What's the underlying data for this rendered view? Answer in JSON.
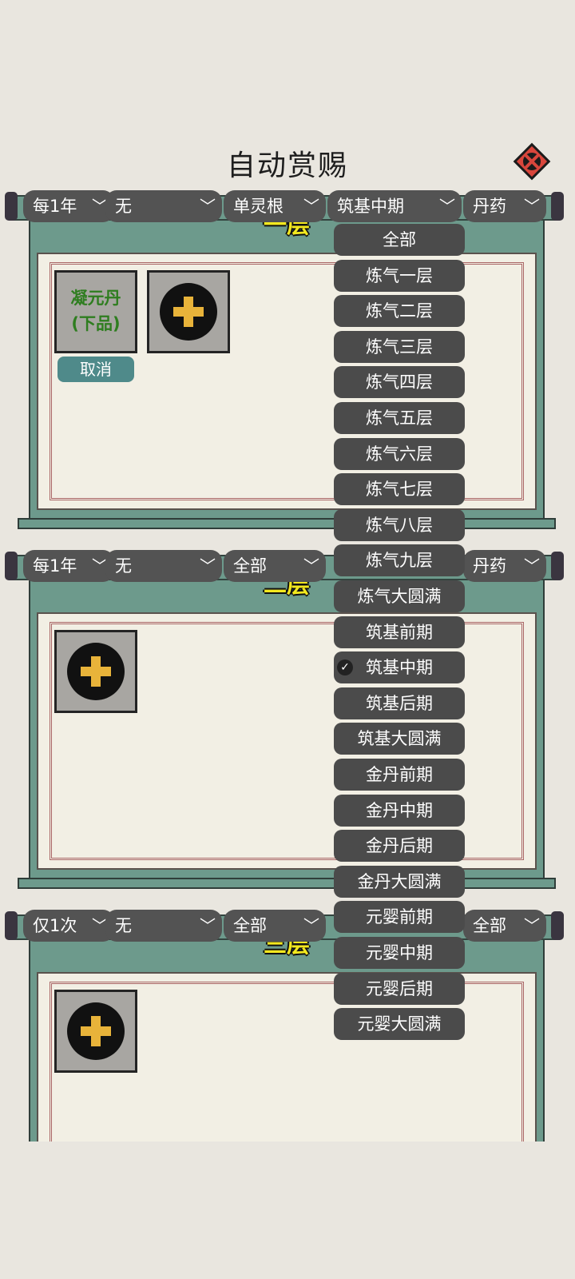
{
  "title": "自动赏赐",
  "close_icon": "close-icon",
  "rows": [
    {
      "freq": "每1年",
      "item": "无",
      "root": "单灵根",
      "realm": "筑基中期",
      "category": "丹药",
      "panel_label": "一层",
      "slot_item": "凝元丹",
      "slot_item_grade": "(下品)",
      "cancel": "取消"
    },
    {
      "freq": "每1年",
      "item": "无",
      "root": "全部",
      "realm": "",
      "category": "丹药",
      "panel_label": "二层"
    },
    {
      "freq": "仅1次",
      "item": "无",
      "root": "全部",
      "realm": "",
      "category": "全部",
      "panel_label": "三层"
    }
  ],
  "realm_menu": {
    "selected": "筑基中期",
    "options": [
      "全部",
      "炼气一层",
      "炼气二层",
      "炼气三层",
      "炼气四层",
      "炼气五层",
      "炼气六层",
      "炼气七层",
      "炼气八层",
      "炼气九层",
      "炼气大圆满",
      "筑基前期",
      "筑基中期",
      "筑基后期",
      "筑基大圆满",
      "金丹前期",
      "金丹中期",
      "金丹后期",
      "金丹大圆满",
      "元婴前期",
      "元婴中期",
      "元婴后期",
      "元婴大圆满"
    ]
  },
  "colors": {
    "panel": "#6d9a8c",
    "label": "#f3e81f",
    "dropdown": "#535353",
    "item_text": "#2e7d1f",
    "plus": "#e8b33a"
  }
}
